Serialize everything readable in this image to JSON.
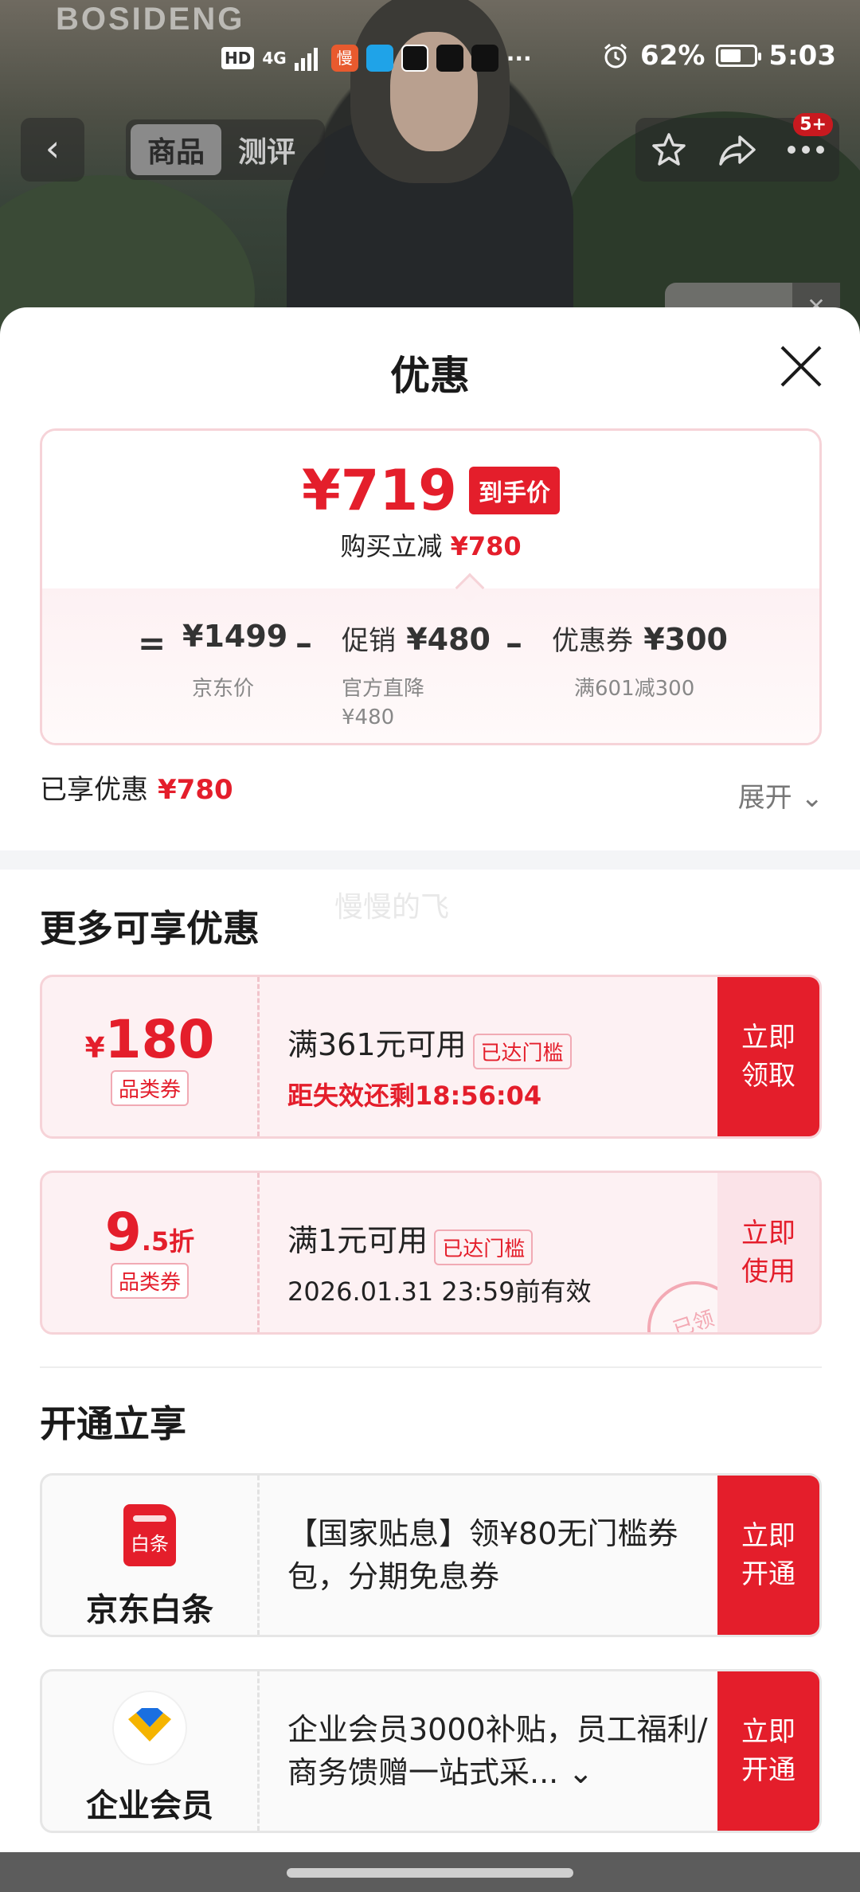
{
  "background": {
    "brand_text": "BOSIDENG"
  },
  "status_bar": {
    "network": "HD",
    "signal_label": "4G",
    "app_icon_text": "慢",
    "more": "···",
    "battery": "62%",
    "battery_level": 0.62,
    "time": "5:03"
  },
  "nav": {
    "back": "‹",
    "tabs": [
      "商品",
      "测评"
    ],
    "active_tab": 0,
    "badge": "5+",
    "side_close": "✕"
  },
  "sheet": {
    "title": "优惠",
    "price_card": {
      "final_price": "¥719",
      "final_tag": "到手价",
      "reduce_label": "购买立减",
      "reduce_value": "¥780",
      "formula": {
        "equals": "=",
        "jd_price": "¥1499",
        "jd_price_label": "京东价",
        "minus1": "–",
        "promo_label": "促销",
        "promo_value": "¥480",
        "promo_sub_1": "官方直降",
        "promo_sub_2": "¥480",
        "minus2": "–",
        "coupon_label": "优惠券",
        "coupon_value": "¥300",
        "coupon_sub": "满601减300"
      }
    },
    "enjoyed_label": "已享优惠",
    "enjoyed_value": "¥780",
    "expand_label": "展开",
    "expand_icon": "⌄",
    "more_title": "更多可享优惠",
    "watermark": "慢慢的飞",
    "coupons": [
      {
        "amount_yen": "¥",
        "amount": "180",
        "category": "品类券",
        "condition": "满361元可用",
        "reached": "已达门槛",
        "note": "距失效还剩18:56:04",
        "action_line1": "立即",
        "action_line2": "领取"
      },
      {
        "amount": "9",
        "amount_suffix": ".5折",
        "category": "品类券",
        "condition": "满1元可用",
        "reached": "已达门槛",
        "note": "2026.01.31 23:59前有效",
        "stamp": "已领",
        "action_line1": "立即",
        "action_line2": "使用"
      }
    ],
    "open_title": "开通立享",
    "services": [
      {
        "icon_text": "白条",
        "name": "京东白条",
        "desc": "【国家贴息】领¥80无门槛券包，分期免息券",
        "action_line1": "立即",
        "action_line2": "开通"
      },
      {
        "name": "企业会员",
        "desc": "企业会员3000补贴，员工福利/商务馈赠一站式采...",
        "desc_icon": "⌄",
        "action_line1": "立即",
        "action_line2": "开通"
      }
    ]
  },
  "colors": {
    "accent_red": "#e41e2b",
    "light_pink": "#fdf1f3"
  }
}
